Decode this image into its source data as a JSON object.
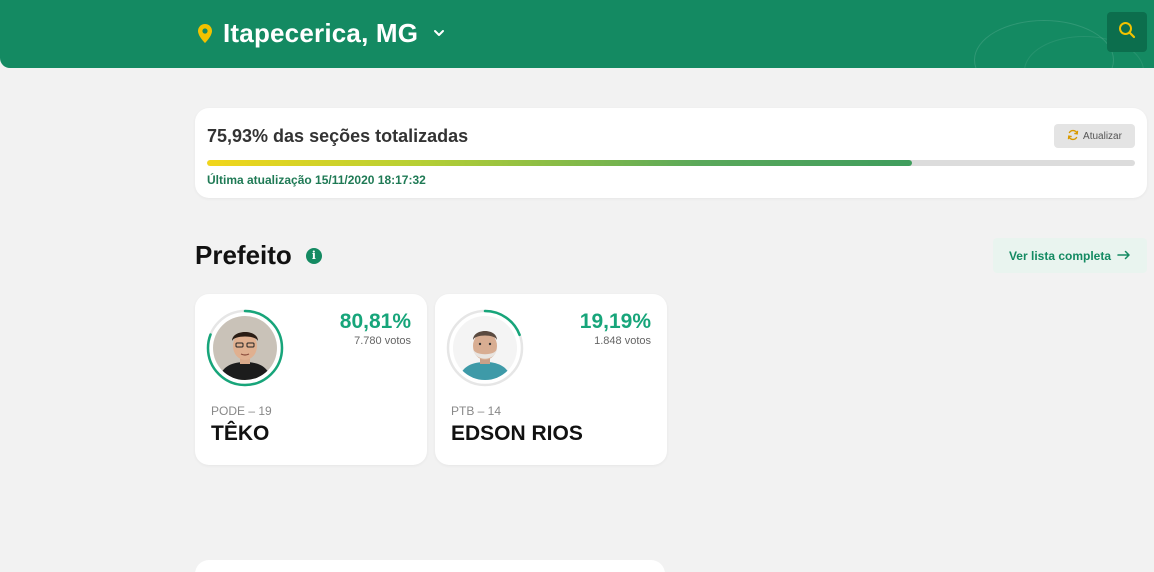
{
  "header": {
    "city": "Itapecerica, MG",
    "location_icon": "map-pin-icon",
    "dropdown_icon": "chevron-down-icon",
    "search_icon": "search-icon",
    "brand_color": "#148a62",
    "accent_color": "#f2c200"
  },
  "progress": {
    "title": "75,93% das seções totalizadas",
    "percent": 75.93,
    "update_button": "Atualizar",
    "update_icon": "refresh-icon",
    "last_update": "Última atualização 15/11/2020 18:17:32"
  },
  "section": {
    "title": "Prefeito",
    "info_icon": "info-icon",
    "full_list_label": "Ver lista completa",
    "full_list_icon": "arrow-right-icon"
  },
  "candidates": [
    {
      "percent_label": "80,81%",
      "percent": 80.81,
      "votes": "7.780 votos",
      "party": "PODE – 19",
      "name": "TÊKO"
    },
    {
      "percent_label": "19,19%",
      "percent": 19.19,
      "votes": "1.848 votos",
      "party": "PTB – 14",
      "name": "EDSON RIOS"
    }
  ]
}
